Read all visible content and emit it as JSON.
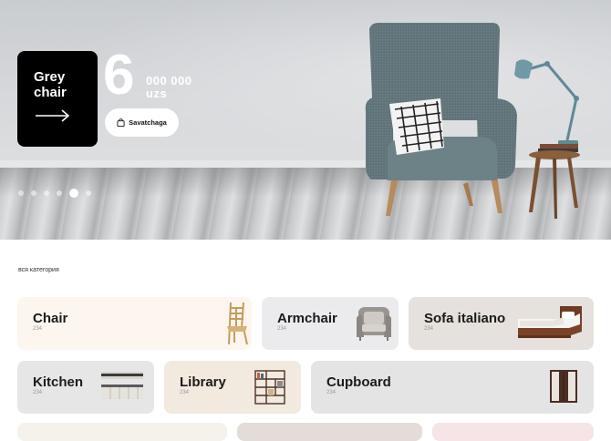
{
  "hero": {
    "title": "Grey\nchair",
    "price_big": "6",
    "price_rest": "000 000",
    "currency": "uzs",
    "basket_label": "Savatchaga",
    "slides_total": 6,
    "slides_active": 5
  },
  "section": {
    "label": "вся категория"
  },
  "categories": [
    {
      "name": "Chair",
      "count": "234",
      "bg": "#fdf6ee"
    },
    {
      "name": "Armchair",
      "count": "234",
      "bg": "#ebebed"
    },
    {
      "name": "Sofa italiano",
      "count": "234",
      "bg": "#e6e1dc"
    },
    {
      "name": "Kitchen",
      "count": "234",
      "bg": "#e6e6e6"
    },
    {
      "name": "Library",
      "count": "234",
      "bg": "#f2e9df"
    },
    {
      "name": "Cupboard",
      "count": "234",
      "bg": "#e4e4e4"
    }
  ],
  "colors": {
    "promo_bg": "#000000",
    "accent_white": "#ffffff"
  }
}
